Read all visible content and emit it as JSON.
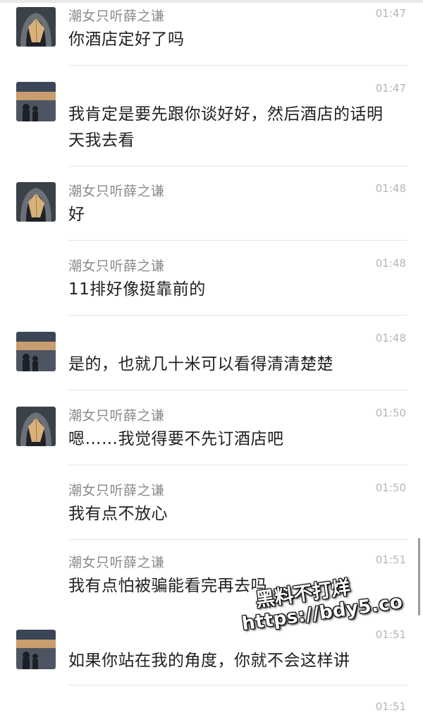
{
  "messages": [
    {
      "sender": "潮女只听薛之谦",
      "time": "01:47",
      "text": "你酒店定好了吗",
      "avatar": "hooded-avatar"
    },
    {
      "sender": "",
      "time": "01:47",
      "text": "我肯定是要先跟你谈好好，然后酒店的话明天我去看",
      "avatar": "sunset-avatar"
    },
    {
      "sender": "潮女只听薛之谦",
      "time": "01:48",
      "text": "好",
      "avatar": "hooded-avatar"
    },
    {
      "sender": "潮女只听薛之谦",
      "time": "01:48",
      "text": "11排好像挺靠前的",
      "avatar": ""
    },
    {
      "sender": "",
      "time": "01:48",
      "text": "是的，也就几十米可以看得清清楚楚",
      "avatar": "sunset-avatar"
    },
    {
      "sender": "潮女只听薛之谦",
      "time": "01:50",
      "text": "嗯……我觉得要不先订酒店吧",
      "avatar": "hooded-avatar"
    },
    {
      "sender": "潮女只听薛之谦",
      "time": "01:50",
      "text": "我有点不放心",
      "avatar": ""
    },
    {
      "sender": "潮女只听薛之谦",
      "time": "01:51",
      "text": "我有点怕被骗能看完再去吗",
      "avatar": ""
    },
    {
      "sender": "",
      "time": "01:51",
      "text": "如果你站在我的角度，你就不会这样讲",
      "avatar": "sunset-avatar"
    },
    {
      "sender": "",
      "time": "01:51",
      "text": "",
      "avatar": ""
    }
  ],
  "watermark": {
    "line1": "黑料不打烊",
    "line2": "https://bdy5.co"
  }
}
